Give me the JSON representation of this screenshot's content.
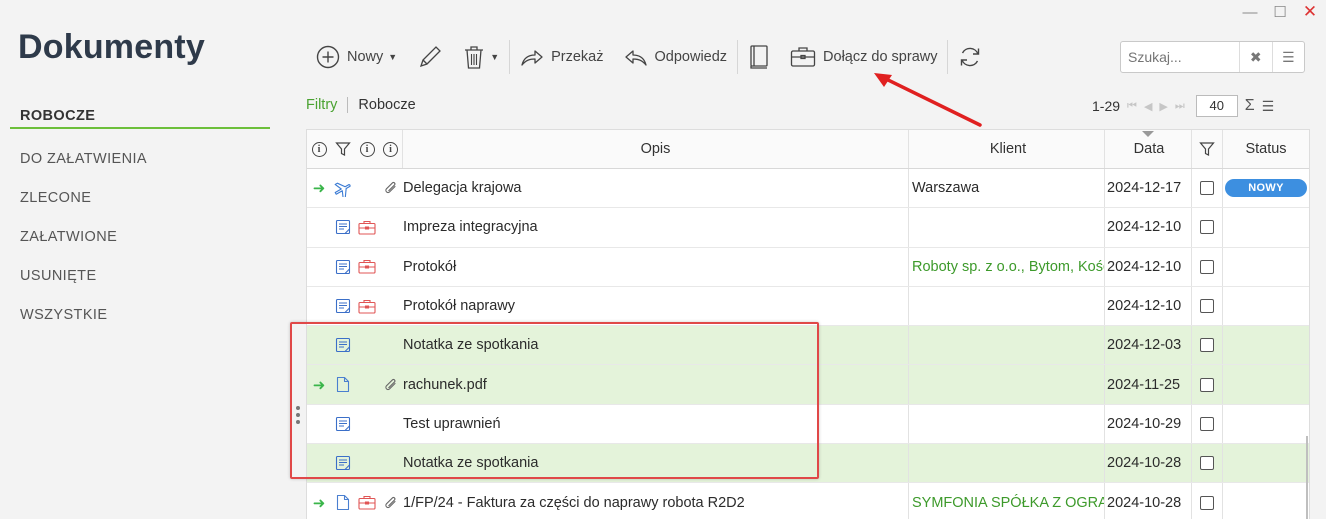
{
  "window": {
    "minimize": "—",
    "maximize": "☐",
    "close": "✕"
  },
  "app": {
    "title": "Dokumenty"
  },
  "nav": {
    "items": [
      {
        "label": "ROBOCZE",
        "active": true
      },
      {
        "label": "DO ZAŁATWIENIA"
      },
      {
        "label": "ZLECONE"
      },
      {
        "label": "ZAŁATWIONE"
      },
      {
        "label": "USUNIĘTE"
      },
      {
        "label": "WSZYSTKIE"
      }
    ]
  },
  "toolbar": {
    "new_label": "Nowy",
    "forward_label": "Przekaż",
    "reply_label": "Odpowiedz",
    "attach_case_label": "Dołącz do sprawy"
  },
  "search": {
    "placeholder": "Szukaj..."
  },
  "breadcrumb": {
    "filters": "Filtry",
    "current": "Robocze"
  },
  "pager": {
    "range": "1-29",
    "page_size": "40"
  },
  "grid": {
    "columns": {
      "opis": "Opis",
      "klient": "Klient",
      "data": "Data",
      "status": "Status"
    },
    "rows": [
      {
        "opis": "Delegacja krajowa",
        "klient": "Warszawa",
        "data": "2024-12-17",
        "status": "NOWY",
        "arrow": true,
        "icon": "plane-icon",
        "attach": true,
        "case": false,
        "highlight": false,
        "client_green": false
      },
      {
        "opis": "Impreza integracyjna",
        "klient": "",
        "data": "2024-12-10",
        "status": "",
        "arrow": false,
        "icon": "note-icon",
        "attach": false,
        "case": true,
        "highlight": false,
        "client_green": false
      },
      {
        "opis": "Protokół",
        "klient": "Roboty sp. z o.o., Bytom, Kości",
        "data": "2024-12-10",
        "status": "",
        "arrow": false,
        "icon": "note-icon",
        "attach": false,
        "case": true,
        "highlight": false,
        "client_green": true
      },
      {
        "opis": "Protokół naprawy",
        "klient": "",
        "data": "2024-12-10",
        "status": "",
        "arrow": false,
        "icon": "note-icon",
        "attach": false,
        "case": true,
        "highlight": false,
        "client_green": false
      },
      {
        "opis": "Notatka ze spotkania",
        "klient": "",
        "data": "2024-12-03",
        "status": "",
        "arrow": false,
        "icon": "note-icon",
        "attach": false,
        "case": false,
        "highlight": true,
        "client_green": false
      },
      {
        "opis": "rachunek.pdf",
        "klient": "",
        "data": "2024-11-25",
        "status": "",
        "arrow": true,
        "icon": "file-icon",
        "attach": true,
        "case": false,
        "highlight": true,
        "client_green": false
      },
      {
        "opis": "Test uprawnień",
        "klient": "",
        "data": "2024-10-29",
        "status": "",
        "arrow": false,
        "icon": "note-icon",
        "attach": false,
        "case": false,
        "highlight": false,
        "client_green": false
      },
      {
        "opis": "Notatka ze spotkania",
        "klient": "",
        "data": "2024-10-28",
        "status": "",
        "arrow": false,
        "icon": "note-icon",
        "attach": false,
        "case": false,
        "highlight": true,
        "client_green": false
      },
      {
        "opis": "1/FP/24 - Faktura za części do naprawy robota R2D2",
        "klient": "SYMFONIA SPÓŁKA Z OGRANI",
        "data": "2024-10-28",
        "status": "",
        "arrow": true,
        "icon": "file-icon",
        "attach": true,
        "case": true,
        "highlight": false,
        "client_green": true
      }
    ]
  },
  "colors": {
    "accent_green": "#4aa231",
    "row_highlight": "#e4f3da",
    "badge_blue": "#3d8fe0",
    "annotation_red": "#e04848"
  }
}
